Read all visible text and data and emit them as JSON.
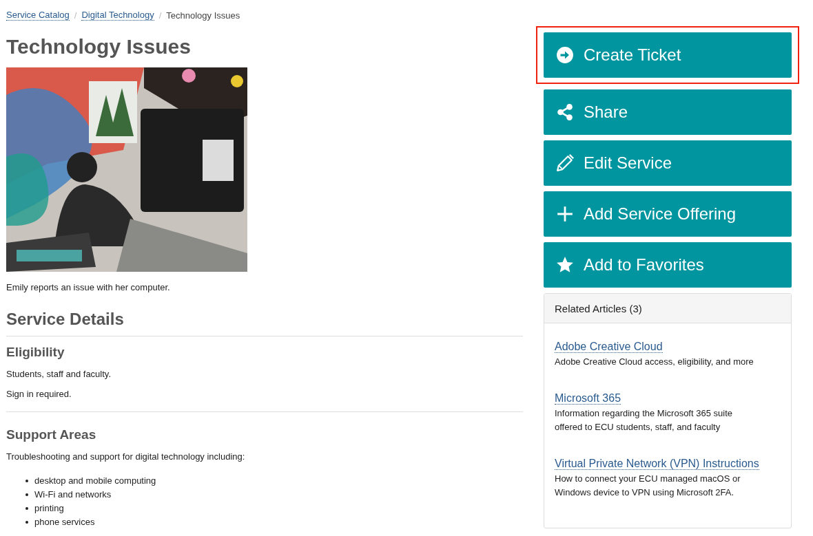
{
  "breadcrumb": [
    {
      "label": "Service Catalog",
      "kind": "link"
    },
    {
      "label": "Digital Technology",
      "kind": "link",
      "separator": "/"
    },
    {
      "label": "Technology Issues",
      "kind": "current",
      "separator": "/"
    }
  ],
  "title": "Technology Issues",
  "caption": "Emily reports an issue with her computer.",
  "details": {
    "heading": "Service Details",
    "sections": [
      {
        "heading": "Eligibility",
        "paragraphs": [
          "Students, staff and faculty.",
          "Sign in required."
        ]
      },
      {
        "heading": "Support Areas",
        "paragraphs": [
          "Troubleshooting and support for digital technology including:"
        ],
        "list": [
          "desktop and mobile computing",
          "Wi-Fi and networks",
          "printing",
          "phone services"
        ]
      }
    ]
  },
  "actions": [
    {
      "label": "Create Ticket",
      "kind": "create",
      "highlighted": true
    },
    {
      "label": "Share",
      "kind": "share",
      "highlighted": false
    },
    {
      "label": "Edit Service",
      "kind": "edit",
      "highlighted": false
    },
    {
      "label": "Add Service Offering",
      "kind": "add",
      "highlighted": false
    },
    {
      "label": "Add to Favorites",
      "kind": "favorite",
      "highlighted": false
    }
  ],
  "related": {
    "title": "Related Articles (3)",
    "articles": [
      {
        "title": "Adobe Creative Cloud",
        "summary": "Adobe Creative Cloud access, eligibility, and more"
      },
      {
        "title": "Microsoft 365",
        "summary": "Information regarding the Microsoft 365 suite offered to ECU students, staff, and faculty"
      },
      {
        "title": "Virtual Private Network (VPN) Instructions",
        "summary": "How to connect your ECU managed macOS or Windows device to VPN using Microsoft 2FA."
      }
    ]
  }
}
